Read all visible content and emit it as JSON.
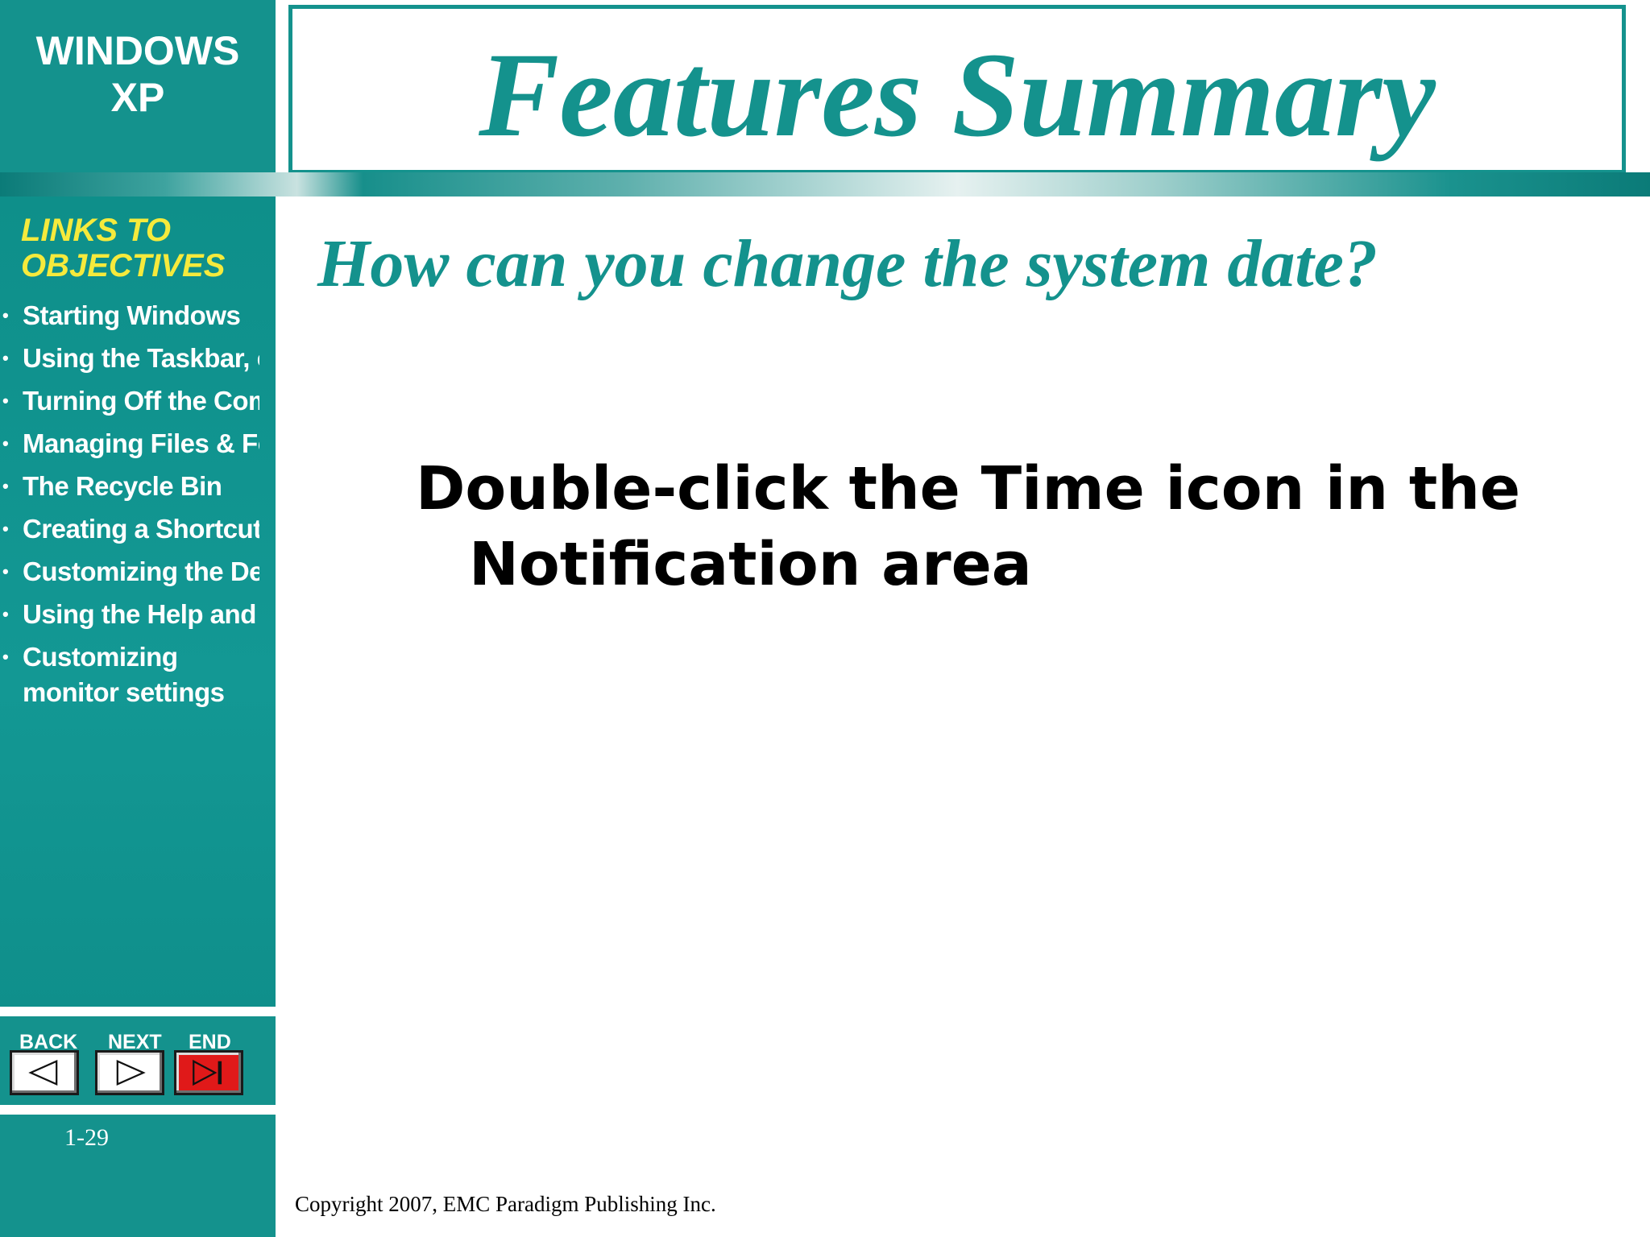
{
  "branding": {
    "line1": "WINDOWS",
    "line2": "XP"
  },
  "title": "Features Summary",
  "question": "How can you change the system date?",
  "answer": "Double-click the Time icon in the Notification area",
  "sidebar": {
    "heading_line1": "LINKS TO",
    "heading_line2": "OBJECTIVES",
    "items": [
      {
        "label": "Starting Windows"
      },
      {
        "label": "Using the Taskbar, op"
      },
      {
        "label": "Turning Off the Comp"
      },
      {
        "label": "Managing Files & Fol"
      },
      {
        "label": "The Recycle Bin"
      },
      {
        "label": "Creating a Shortcut"
      },
      {
        "label": "Customizing the Des"
      },
      {
        "label": "Using the Help and S"
      },
      {
        "label": "Customizing monitor settings"
      }
    ]
  },
  "nav": {
    "back_label": "BACK",
    "next_label": "NEXT",
    "end_label": "END",
    "back_icon": "back-arrow-icon",
    "next_icon": "next-arrow-icon",
    "end_icon": "end-arrow-icon",
    "end_color": "#e01919"
  },
  "page_number": "1-29",
  "copyright": "Copyright 2007, EMC Paradigm Publishing Inc.",
  "colors": {
    "teal": "#14928d",
    "heading_yellow": "#f5ea3c"
  }
}
